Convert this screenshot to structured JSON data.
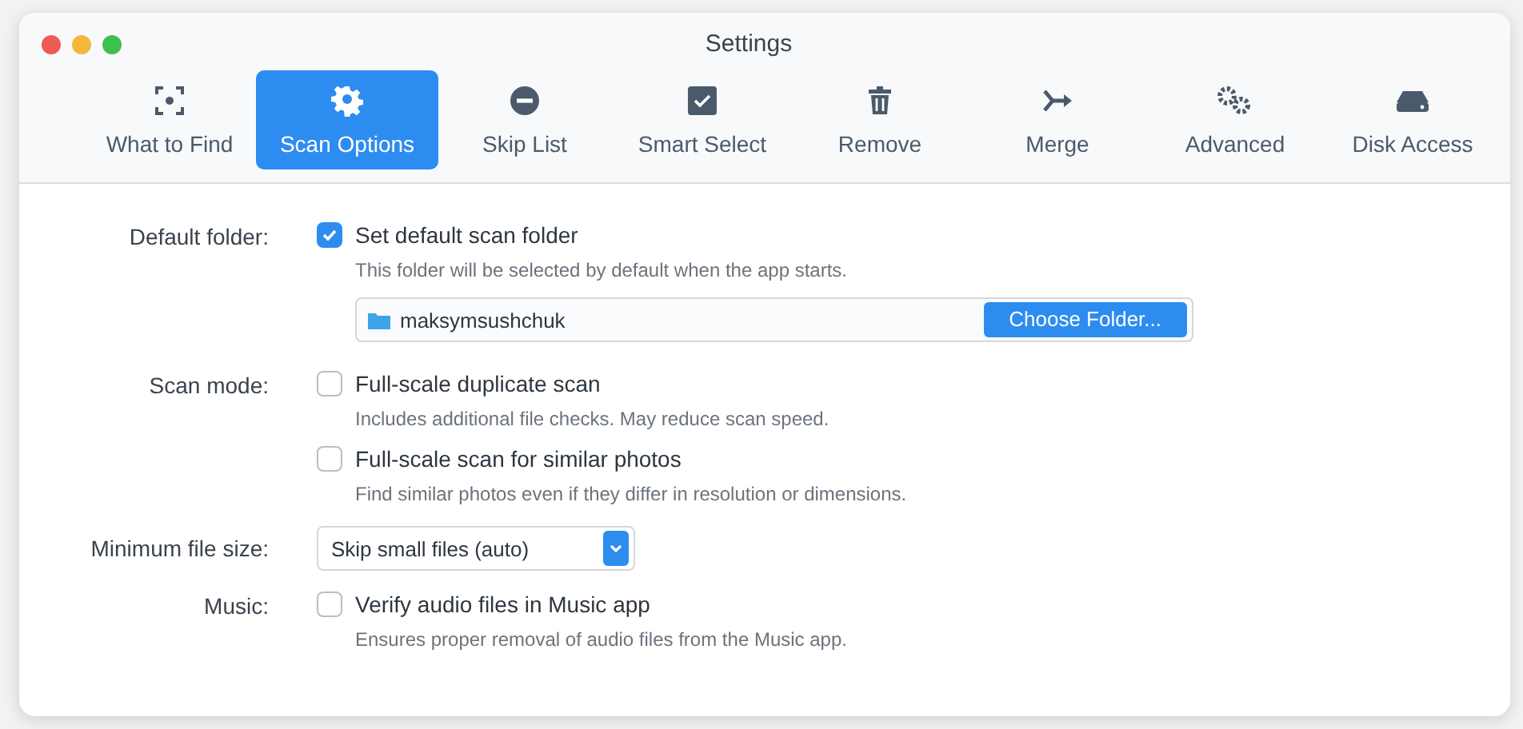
{
  "window": {
    "title": "Settings"
  },
  "tabs": [
    {
      "label": "What to Find",
      "selected": false
    },
    {
      "label": "Scan Options",
      "selected": true
    },
    {
      "label": "Skip List",
      "selected": false
    },
    {
      "label": "Smart Select",
      "selected": false
    },
    {
      "label": "Remove",
      "selected": false
    },
    {
      "label": "Merge",
      "selected": false
    },
    {
      "label": "Advanced",
      "selected": false
    },
    {
      "label": "Disk Access",
      "selected": false
    }
  ],
  "sections": [
    {
      "label": "Default folder:",
      "items": [
        {
          "kind": "checkbox",
          "label": "Set default scan folder",
          "checked": true,
          "description": "This folder will be selected by default when the app starts."
        },
        {
          "kind": "folder",
          "value": "maksymsushchuk",
          "button": "Choose Folder..."
        }
      ]
    },
    {
      "label": "Scan mode:",
      "items": [
        {
          "kind": "checkbox",
          "label": "Full-scale duplicate scan",
          "checked": false,
          "description": "Includes additional file checks. May reduce scan speed."
        },
        {
          "kind": "checkbox",
          "label": "Full-scale scan for similar photos",
          "checked": false,
          "description": "Find similar photos even if they differ in resolution or dimensions."
        }
      ]
    },
    {
      "label": "Minimum file size:",
      "items": [
        {
          "kind": "select",
          "value": "Skip small files (auto)"
        }
      ]
    },
    {
      "label": "Music:",
      "items": [
        {
          "kind": "checkbox",
          "label": "Verify audio files in Music app",
          "checked": false,
          "description": "Ensures proper removal of audio files from the Music app."
        }
      ]
    }
  ]
}
